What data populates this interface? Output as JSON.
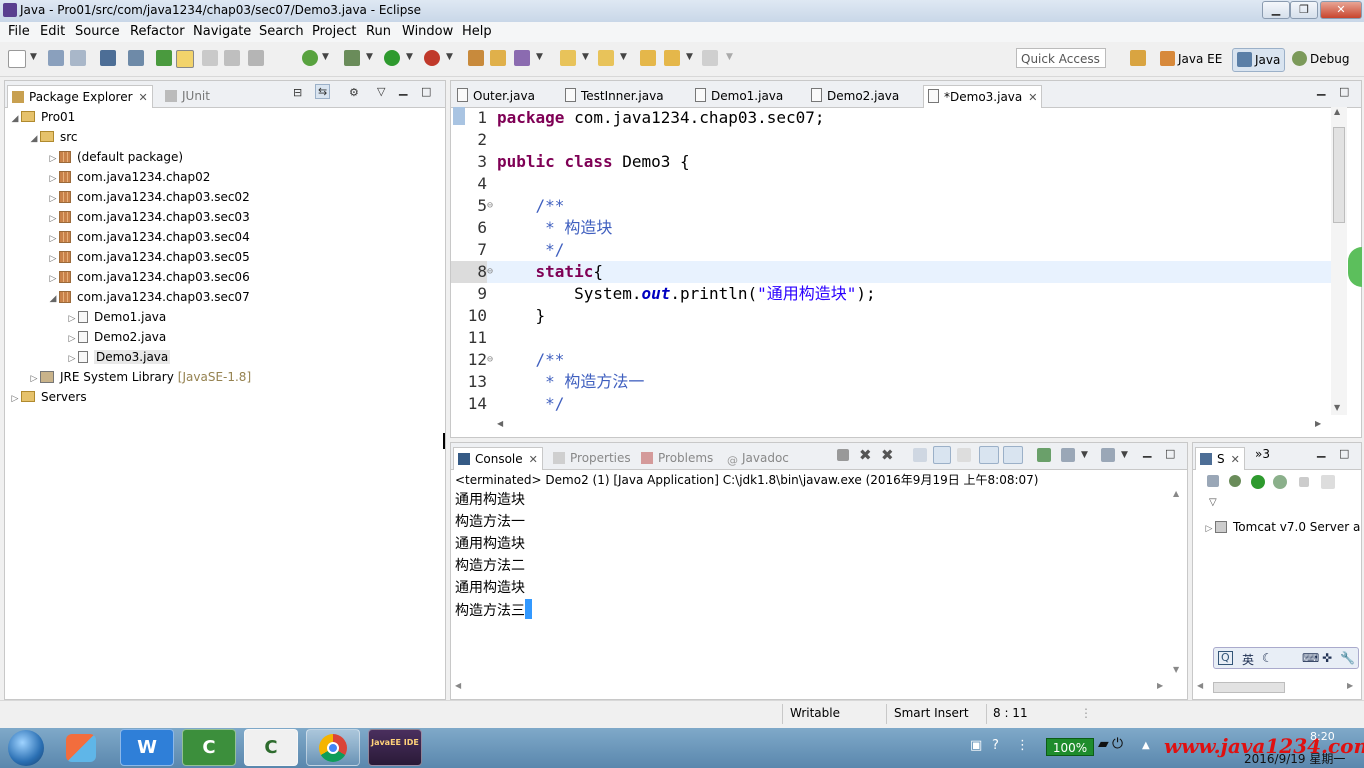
{
  "window": {
    "title": "Java - Pro01/src/com/java1234/chap03/sec07/Demo3.java - Eclipse",
    "controls": [
      "▁",
      "❐",
      "✕"
    ]
  },
  "menu": [
    "File",
    "Edit",
    "Source",
    "Refactor",
    "Navigate",
    "Search",
    "Project",
    "Run",
    "Window",
    "Help"
  ],
  "toolbar": {
    "quick_access": "Quick Access",
    "perspectives": [
      {
        "label": "Java EE",
        "icon": "java-ee-perspective-icon"
      },
      {
        "label": "Java",
        "icon": "java-perspective-icon",
        "active": true
      },
      {
        "label": "Debug",
        "icon": "debug-perspective-icon"
      }
    ]
  },
  "explorer": {
    "tabs": [
      {
        "label": "Package Explorer",
        "active": true
      },
      {
        "label": "JUnit",
        "active": false
      }
    ],
    "tree": [
      {
        "label": "Pro01",
        "depth": 0,
        "icon": "project",
        "expanded": true
      },
      {
        "label": "src",
        "depth": 1,
        "icon": "source-folder",
        "expanded": true
      },
      {
        "label": "(default package)",
        "depth": 2,
        "icon": "package",
        "expanded": false
      },
      {
        "label": "com.java1234.chap02",
        "depth": 2,
        "icon": "package",
        "expanded": false
      },
      {
        "label": "com.java1234.chap03.sec02",
        "depth": 2,
        "icon": "package",
        "expanded": false
      },
      {
        "label": "com.java1234.chap03.sec03",
        "depth": 2,
        "icon": "package",
        "expanded": false
      },
      {
        "label": "com.java1234.chap03.sec04",
        "depth": 2,
        "icon": "package",
        "expanded": false
      },
      {
        "label": "com.java1234.chap03.sec05",
        "depth": 2,
        "icon": "package",
        "expanded": false
      },
      {
        "label": "com.java1234.chap03.sec06",
        "depth": 2,
        "icon": "package",
        "expanded": false
      },
      {
        "label": "com.java1234.chap03.sec07",
        "depth": 2,
        "icon": "package",
        "expanded": true
      },
      {
        "label": "Demo1.java",
        "depth": 3,
        "icon": "java-file",
        "expanded": false
      },
      {
        "label": "Demo2.java",
        "depth": 3,
        "icon": "java-file",
        "expanded": false
      },
      {
        "label": "Demo3.java",
        "depth": 3,
        "icon": "java-file",
        "expanded": false,
        "selected": true
      },
      {
        "label": "JRE System Library",
        "suffix": "[JavaSE-1.8]",
        "depth": 1,
        "icon": "library",
        "expanded": false
      },
      {
        "label": "Servers",
        "depth": 0,
        "icon": "folder",
        "expanded": false
      }
    ]
  },
  "editor": {
    "tabs": [
      {
        "label": "Outer.java",
        "active": false
      },
      {
        "label": "TestInner.java",
        "active": false
      },
      {
        "label": "Demo1.java",
        "active": false
      },
      {
        "label": "Demo2.java",
        "active": false
      },
      {
        "label": "*Demo3.java",
        "active": true
      }
    ],
    "lines": [
      {
        "n": "1",
        "tokens": [
          [
            "kw",
            "package"
          ],
          [
            "",
            " com.java1234.chap03.sec07;"
          ]
        ]
      },
      {
        "n": "2",
        "tokens": []
      },
      {
        "n": "3",
        "tokens": [
          [
            "kw",
            "public"
          ],
          [
            "",
            " "
          ],
          [
            "kw",
            "class"
          ],
          [
            "",
            " Demo3 {"
          ]
        ]
      },
      {
        "n": "4",
        "tokens": []
      },
      {
        "n": "5",
        "fold": true,
        "tokens": [
          [
            "cm",
            "    /**"
          ]
        ]
      },
      {
        "n": "6",
        "tokens": [
          [
            "cm",
            "     * 构造块"
          ]
        ]
      },
      {
        "n": "7",
        "tokens": [
          [
            "cm",
            "     */"
          ]
        ]
      },
      {
        "n": "8",
        "fold": true,
        "current": true,
        "tokens": [
          [
            "",
            "    "
          ],
          [
            "kw",
            "static"
          ],
          [
            "",
            "{"
          ]
        ]
      },
      {
        "n": "9",
        "tokens": [
          [
            "",
            "        System."
          ],
          [
            "fld",
            "out"
          ],
          [
            "",
            ".println("
          ],
          [
            "str",
            "\"通用构造块\""
          ],
          [
            "",
            ");"
          ]
        ]
      },
      {
        "n": "10",
        "tokens": [
          [
            "",
            "    }"
          ]
        ]
      },
      {
        "n": "11",
        "tokens": []
      },
      {
        "n": "12",
        "fold": true,
        "tokens": [
          [
            "cm",
            "    /**"
          ]
        ]
      },
      {
        "n": "13",
        "tokens": [
          [
            "cm",
            "     * 构造方法一"
          ]
        ]
      },
      {
        "n": "14",
        "tokens": [
          [
            "cm",
            "     */"
          ]
        ]
      }
    ]
  },
  "console": {
    "tabs": [
      {
        "label": "Console",
        "active": true
      },
      {
        "label": "Properties",
        "active": false
      },
      {
        "label": "Problems",
        "active": false
      },
      {
        "label": "Javadoc",
        "active": false
      }
    ],
    "status": "<terminated> Demo2 (1) [Java Application] C:\\jdk1.8\\bin\\javaw.exe (2016年9月19日 上午8:08:07)",
    "lines": [
      "通用构造块",
      "构造方法一",
      "通用构造块",
      "构造方法二",
      "通用构造块",
      "构造方法三"
    ]
  },
  "servers": {
    "tab": "S",
    "overflow": "»3",
    "items": [
      "Tomcat v7.0 Server a"
    ],
    "ime": [
      "英",
      "☾",
      "⌨",
      "✜",
      "🔧"
    ]
  },
  "statusbar": {
    "writable": "Writable",
    "insert": "Smart Insert",
    "position": "8 : 11"
  },
  "taskbar": {
    "apps": [
      "W",
      "C",
      "C",
      "JavaEE IDE"
    ],
    "battery": "100%",
    "watermark": "www.java1234.com",
    "clock_time": "8:20",
    "clock_date": "2016/9/19 星期一"
  },
  "colors": {
    "keyword": "#7f0055",
    "comment": "#3f5fbf",
    "string": "#2a00ff",
    "field": "#0000c0",
    "selection": "#3399ff",
    "current_line": "#e8f2fe"
  }
}
